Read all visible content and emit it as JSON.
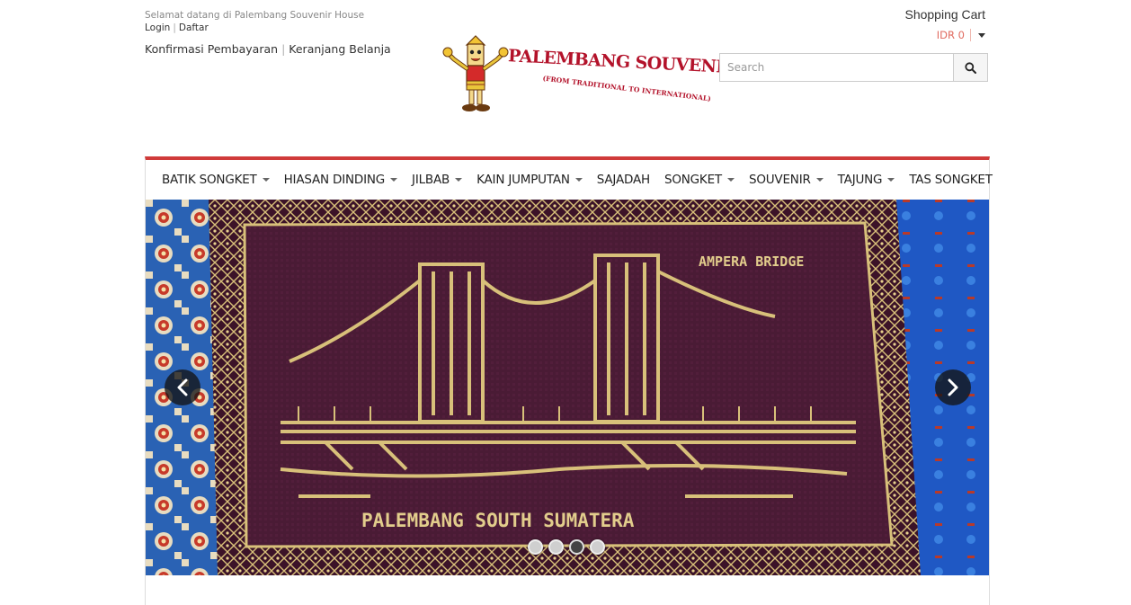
{
  "header": {
    "welcome": "Selamat datang di Palembang Souvenir House",
    "login": "Login",
    "register": "Daftar",
    "payment_confirm": "Konfirmasi Pembayaran",
    "shopping_bag": "Keranjang Belanja",
    "logo_title": "PALEMBANG SOUVENIR HOUSE",
    "logo_tagline": "(FROM TRADITIONAL TO INTERNATIONAL)"
  },
  "cart": {
    "title": "Shopping Cart",
    "amount": "IDR 0"
  },
  "search": {
    "placeholder": "Search",
    "icon": "search-icon"
  },
  "nav": {
    "items": [
      {
        "label": "BATIK SONGKET",
        "dropdown": true
      },
      {
        "label": "HIASAN DINDING",
        "dropdown": true
      },
      {
        "label": "JILBAB",
        "dropdown": true
      },
      {
        "label": "KAIN JUMPUTAN",
        "dropdown": true
      },
      {
        "label": "SAJADAH",
        "dropdown": false
      },
      {
        "label": "SONGKET",
        "dropdown": true
      },
      {
        "label": "SOUVENIR",
        "dropdown": true
      },
      {
        "label": "TAJUNG",
        "dropdown": true
      },
      {
        "label": "TAS SONGKET",
        "dropdown": false
      }
    ]
  },
  "slider": {
    "slide_text_top": "AMPERA BRIDGE",
    "slide_text_bottom": "PALEMBANG SOUTH SUMATERA",
    "dot_count": 4,
    "active_dot": 3,
    "prev_icon": "chevron-left-icon",
    "next_icon": "chevron-right-icon"
  },
  "colors": {
    "accent": "#d03b3a",
    "logo_red": "#b3122a",
    "cart_amount": "#e06a5f",
    "carpet_blue": "#2f72c8",
    "fabric_purple": "#4a1b35",
    "gold_thread": "#d8c07a"
  }
}
